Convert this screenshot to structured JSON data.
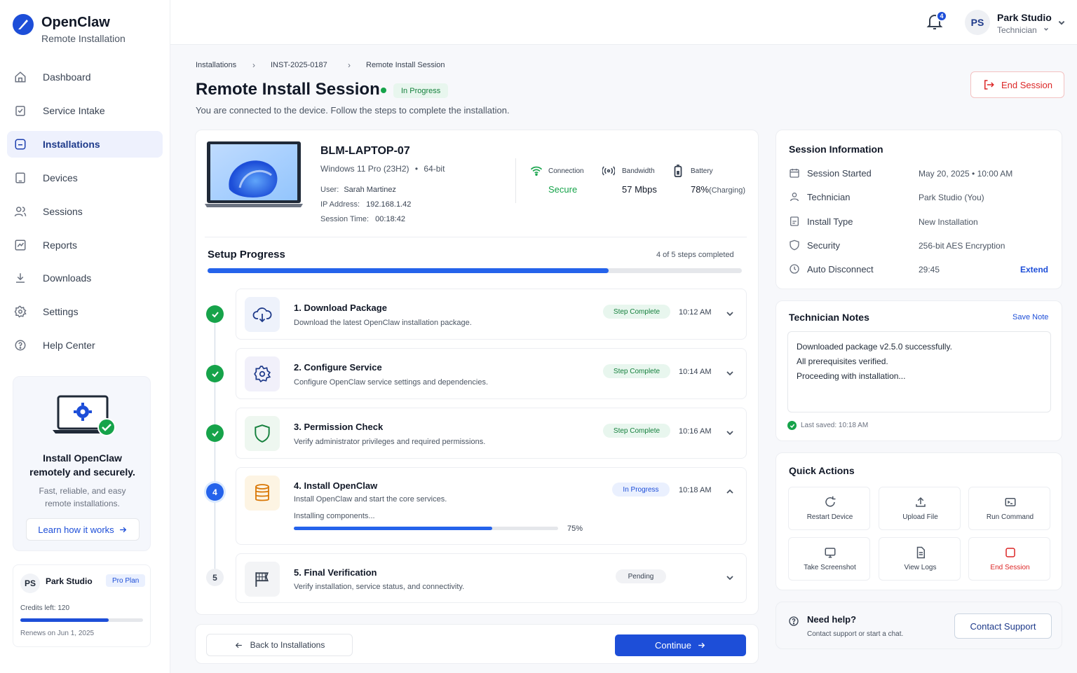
{
  "brand": {
    "name": "OpenClaw",
    "subtitle": "Remote Installation"
  },
  "nav": [
    {
      "label": "Dashboard",
      "icon": "home-icon"
    },
    {
      "label": "Service Intake",
      "icon": "clipboard-icon"
    },
    {
      "label": "Installations",
      "icon": "install-icon",
      "active": true
    },
    {
      "label": "Devices",
      "icon": "tablet-icon"
    },
    {
      "label": "Sessions",
      "icon": "users-icon"
    },
    {
      "label": "Reports",
      "icon": "chart-icon"
    },
    {
      "label": "Downloads",
      "icon": "download-icon"
    },
    {
      "label": "Settings",
      "icon": "gear-icon"
    },
    {
      "label": "Help Center",
      "icon": "help-icon"
    }
  ],
  "promo": {
    "title_line1": "Install OpenClaw",
    "title_line2": "remotely and securely.",
    "desc_line1": "Fast, reliable, and easy",
    "desc_line2": "remote installations.",
    "button": "Learn how it works"
  },
  "account": {
    "initials": "PS",
    "name": "Park Studio",
    "plan": "Pro Plan",
    "credits": "Credits left: 120",
    "credits_fraction": 0.72,
    "renews": "Renews on Jun 1, 2025"
  },
  "topbar": {
    "notifications": "4",
    "user_initials": "PS",
    "user_name": "Park Studio",
    "user_role": "Technician"
  },
  "breadcrumb": [
    "Installations",
    "INST-2025-0187",
    "Remote Install Session"
  ],
  "page": {
    "title": "Remote Install Session",
    "status": "In Progress",
    "subtitle": "You are connected to the device. Follow the steps to complete the installation.",
    "end_button": "End Session"
  },
  "device": {
    "name": "BLM-LAPTOP-07",
    "os": "Windows 11 Pro (23H2)",
    "arch": "64-bit",
    "user_label": "User:",
    "user": "Sarah Martinez",
    "ip_label": "IP Address:",
    "ip": "192.168.1.42",
    "time_label": "Session Time:",
    "time": "00:18:42",
    "connection_label": "Connection",
    "connection": "Secure",
    "bandwidth_label": "Bandwidth",
    "bandwidth": "57 Mbps",
    "battery_label": "Battery",
    "battery": "78%",
    "battery_note": "(Charging)"
  },
  "progress": {
    "title": "Setup Progress",
    "summary": "4 of 5 steps completed",
    "fraction": 0.75
  },
  "steps": [
    {
      "num": "1",
      "title": "1. Download Package",
      "desc": "Download the latest OpenClaw installation package.",
      "status": "Step Complete",
      "time": "10:12 AM",
      "state": "done",
      "icon": "cloud-download-icon"
    },
    {
      "num": "2",
      "title": "2. Configure Service",
      "desc": "Configure OpenClaw service settings and dependencies.",
      "status": "Step Complete",
      "time": "10:14 AM",
      "state": "done",
      "icon": "gear-icon"
    },
    {
      "num": "3",
      "title": "3. Permission Check",
      "desc": "Verify administrator privileges and required permissions.",
      "status": "Step Complete",
      "time": "10:16 AM",
      "state": "done",
      "icon": "shield-icon"
    },
    {
      "num": "4",
      "title": "4. Install OpenClaw",
      "desc": "Install OpenClaw and start the core services.",
      "status": "In Progress",
      "time": "10:18 AM",
      "state": "active",
      "icon": "database-icon",
      "sub_label": "Installing components...",
      "sub_percent": "75%",
      "sub_fraction": 0.75
    },
    {
      "num": "5",
      "title": "5. Final Verification",
      "desc": "Verify installation, service status, and connectivity.",
      "status": "Pending",
      "time": "",
      "state": "pending",
      "icon": "flag-icon"
    }
  ],
  "footer": {
    "back": "Back to Installations",
    "continue": "Continue"
  },
  "session_info": {
    "title": "Session Information",
    "rows": [
      {
        "label": "Session Started",
        "value": "May 20, 2025  •  10:00 AM",
        "icon": "calendar-icon"
      },
      {
        "label": "Technician",
        "value": "Park Studio (You)",
        "icon": "user-icon"
      },
      {
        "label": "Install Type",
        "value": "New Installation",
        "icon": "install-type-icon"
      },
      {
        "label": "Security",
        "value": "256-bit AES Encryption",
        "icon": "shield-icon"
      },
      {
        "label": "Auto Disconnect",
        "value": "29:45",
        "icon": "clock-icon"
      }
    ],
    "extend": "Extend"
  },
  "notes": {
    "title": "Technician Notes",
    "save": "Save Note",
    "lines": [
      "Downloaded package v2.5.0 successfully.",
      "All prerequisites verified.",
      "Proceeding with installation..."
    ],
    "saved": "Last saved: 10:18 AM"
  },
  "quick_actions": {
    "title": "Quick Actions",
    "items": [
      {
        "label": "Restart Device",
        "icon": "refresh-icon"
      },
      {
        "label": "Upload File",
        "icon": "upload-icon"
      },
      {
        "label": "Run Command",
        "icon": "terminal-icon"
      },
      {
        "label": "Take Screenshot",
        "icon": "monitor-icon"
      },
      {
        "label": "View Logs",
        "icon": "document-icon"
      },
      {
        "label": "End Session",
        "icon": "stop-icon",
        "danger": true
      }
    ]
  },
  "help": {
    "title": "Need help?",
    "desc": "Contact support or start a chat.",
    "button": "Contact Support"
  },
  "colors": {
    "primary": "#1d4ed8",
    "success": "#16a34a",
    "danger": "#dc2626",
    "accent_bg": "#eef1fd"
  }
}
